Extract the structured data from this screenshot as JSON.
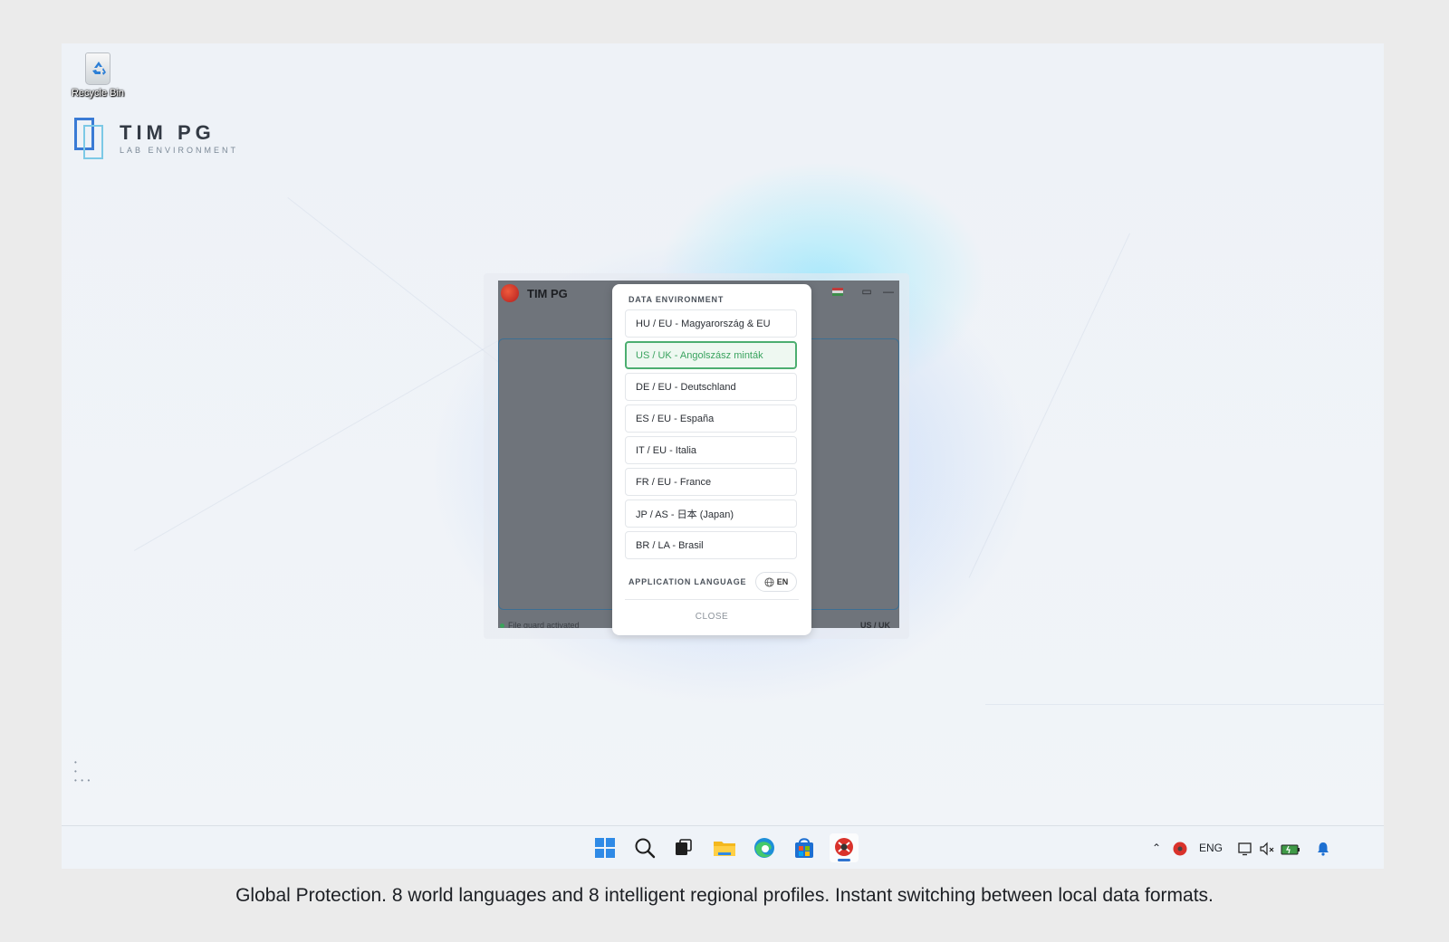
{
  "desktop": {
    "recycle_bin_label": "Recycle Bin",
    "brand": {
      "title": "TIM PG",
      "subtitle": "LAB ENVIRONMENT"
    }
  },
  "app": {
    "title": "TIM PG",
    "status_text": "File guard activated",
    "region_badge": "US / UK"
  },
  "dialog": {
    "heading": "DATA ENVIRONMENT",
    "environments": [
      {
        "label": "HU / EU - Magyarország & EU",
        "selected": false
      },
      {
        "label": "US / UK - Angolszász minták",
        "selected": true
      },
      {
        "label": "DE / EU - Deutschland",
        "selected": false
      },
      {
        "label": "ES / EU - España",
        "selected": false
      },
      {
        "label": "IT / EU - Italia",
        "selected": false
      },
      {
        "label": "FR / EU - France",
        "selected": false
      },
      {
        "label": "JP / AS - 日本 (Japan)",
        "selected": false
      },
      {
        "label": "BR / LA - Brasil",
        "selected": false
      }
    ],
    "language_label": "APPLICATION LANGUAGE",
    "language_value": "EN",
    "close_label": "CLOSE"
  },
  "taskbar": {
    "tray_language": "ENG"
  },
  "caption": "Global Protection. 8 world languages and 8 intelligent regional profiles. Instant switching between local data formats.",
  "colors": {
    "selected_accent": "#4cae70",
    "app_overlay": "#6f747b",
    "windows_blue": "#2f74d0"
  }
}
